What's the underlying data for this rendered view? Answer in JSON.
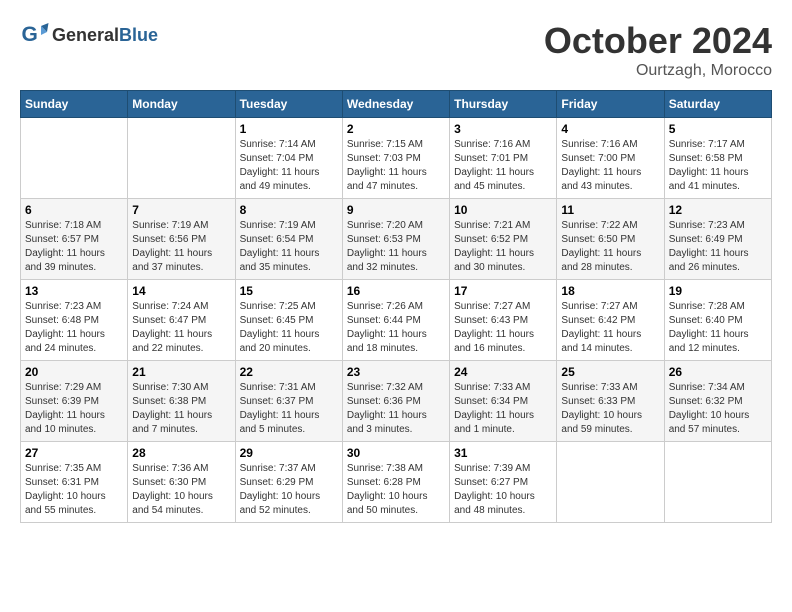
{
  "header": {
    "logo_general": "General",
    "logo_blue": "Blue",
    "month": "October 2024",
    "location": "Ourtzagh, Morocco"
  },
  "weekdays": [
    "Sunday",
    "Monday",
    "Tuesday",
    "Wednesday",
    "Thursday",
    "Friday",
    "Saturday"
  ],
  "weeks": [
    [
      {
        "day": "",
        "empty": true
      },
      {
        "day": "",
        "empty": true
      },
      {
        "day": "1",
        "sunrise": "7:14 AM",
        "sunset": "7:04 PM",
        "daylight": "11 hours and 49 minutes."
      },
      {
        "day": "2",
        "sunrise": "7:15 AM",
        "sunset": "7:03 PM",
        "daylight": "11 hours and 47 minutes."
      },
      {
        "day": "3",
        "sunrise": "7:16 AM",
        "sunset": "7:01 PM",
        "daylight": "11 hours and 45 minutes."
      },
      {
        "day": "4",
        "sunrise": "7:16 AM",
        "sunset": "7:00 PM",
        "daylight": "11 hours and 43 minutes."
      },
      {
        "day": "5",
        "sunrise": "7:17 AM",
        "sunset": "6:58 PM",
        "daylight": "11 hours and 41 minutes."
      }
    ],
    [
      {
        "day": "6",
        "sunrise": "7:18 AM",
        "sunset": "6:57 PM",
        "daylight": "11 hours and 39 minutes."
      },
      {
        "day": "7",
        "sunrise": "7:19 AM",
        "sunset": "6:56 PM",
        "daylight": "11 hours and 37 minutes."
      },
      {
        "day": "8",
        "sunrise": "7:19 AM",
        "sunset": "6:54 PM",
        "daylight": "11 hours and 35 minutes."
      },
      {
        "day": "9",
        "sunrise": "7:20 AM",
        "sunset": "6:53 PM",
        "daylight": "11 hours and 32 minutes."
      },
      {
        "day": "10",
        "sunrise": "7:21 AM",
        "sunset": "6:52 PM",
        "daylight": "11 hours and 30 minutes."
      },
      {
        "day": "11",
        "sunrise": "7:22 AM",
        "sunset": "6:50 PM",
        "daylight": "11 hours and 28 minutes."
      },
      {
        "day": "12",
        "sunrise": "7:23 AM",
        "sunset": "6:49 PM",
        "daylight": "11 hours and 26 minutes."
      }
    ],
    [
      {
        "day": "13",
        "sunrise": "7:23 AM",
        "sunset": "6:48 PM",
        "daylight": "11 hours and 24 minutes."
      },
      {
        "day": "14",
        "sunrise": "7:24 AM",
        "sunset": "6:47 PM",
        "daylight": "11 hours and 22 minutes."
      },
      {
        "day": "15",
        "sunrise": "7:25 AM",
        "sunset": "6:45 PM",
        "daylight": "11 hours and 20 minutes."
      },
      {
        "day": "16",
        "sunrise": "7:26 AM",
        "sunset": "6:44 PM",
        "daylight": "11 hours and 18 minutes."
      },
      {
        "day": "17",
        "sunrise": "7:27 AM",
        "sunset": "6:43 PM",
        "daylight": "11 hours and 16 minutes."
      },
      {
        "day": "18",
        "sunrise": "7:27 AM",
        "sunset": "6:42 PM",
        "daylight": "11 hours and 14 minutes."
      },
      {
        "day": "19",
        "sunrise": "7:28 AM",
        "sunset": "6:40 PM",
        "daylight": "11 hours and 12 minutes."
      }
    ],
    [
      {
        "day": "20",
        "sunrise": "7:29 AM",
        "sunset": "6:39 PM",
        "daylight": "11 hours and 10 minutes."
      },
      {
        "day": "21",
        "sunrise": "7:30 AM",
        "sunset": "6:38 PM",
        "daylight": "11 hours and 7 minutes."
      },
      {
        "day": "22",
        "sunrise": "7:31 AM",
        "sunset": "6:37 PM",
        "daylight": "11 hours and 5 minutes."
      },
      {
        "day": "23",
        "sunrise": "7:32 AM",
        "sunset": "6:36 PM",
        "daylight": "11 hours and 3 minutes."
      },
      {
        "day": "24",
        "sunrise": "7:33 AM",
        "sunset": "6:34 PM",
        "daylight": "11 hours and 1 minute."
      },
      {
        "day": "25",
        "sunrise": "7:33 AM",
        "sunset": "6:33 PM",
        "daylight": "10 hours and 59 minutes."
      },
      {
        "day": "26",
        "sunrise": "7:34 AM",
        "sunset": "6:32 PM",
        "daylight": "10 hours and 57 minutes."
      }
    ],
    [
      {
        "day": "27",
        "sunrise": "7:35 AM",
        "sunset": "6:31 PM",
        "daylight": "10 hours and 55 minutes."
      },
      {
        "day": "28",
        "sunrise": "7:36 AM",
        "sunset": "6:30 PM",
        "daylight": "10 hours and 54 minutes."
      },
      {
        "day": "29",
        "sunrise": "7:37 AM",
        "sunset": "6:29 PM",
        "daylight": "10 hours and 52 minutes."
      },
      {
        "day": "30",
        "sunrise": "7:38 AM",
        "sunset": "6:28 PM",
        "daylight": "10 hours and 50 minutes."
      },
      {
        "day": "31",
        "sunrise": "7:39 AM",
        "sunset": "6:27 PM",
        "daylight": "10 hours and 48 minutes."
      },
      {
        "day": "",
        "empty": true
      },
      {
        "day": "",
        "empty": true
      }
    ]
  ],
  "labels": {
    "sunrise_prefix": "Sunrise: ",
    "sunset_prefix": "Sunset: ",
    "daylight_prefix": "Daylight: "
  }
}
